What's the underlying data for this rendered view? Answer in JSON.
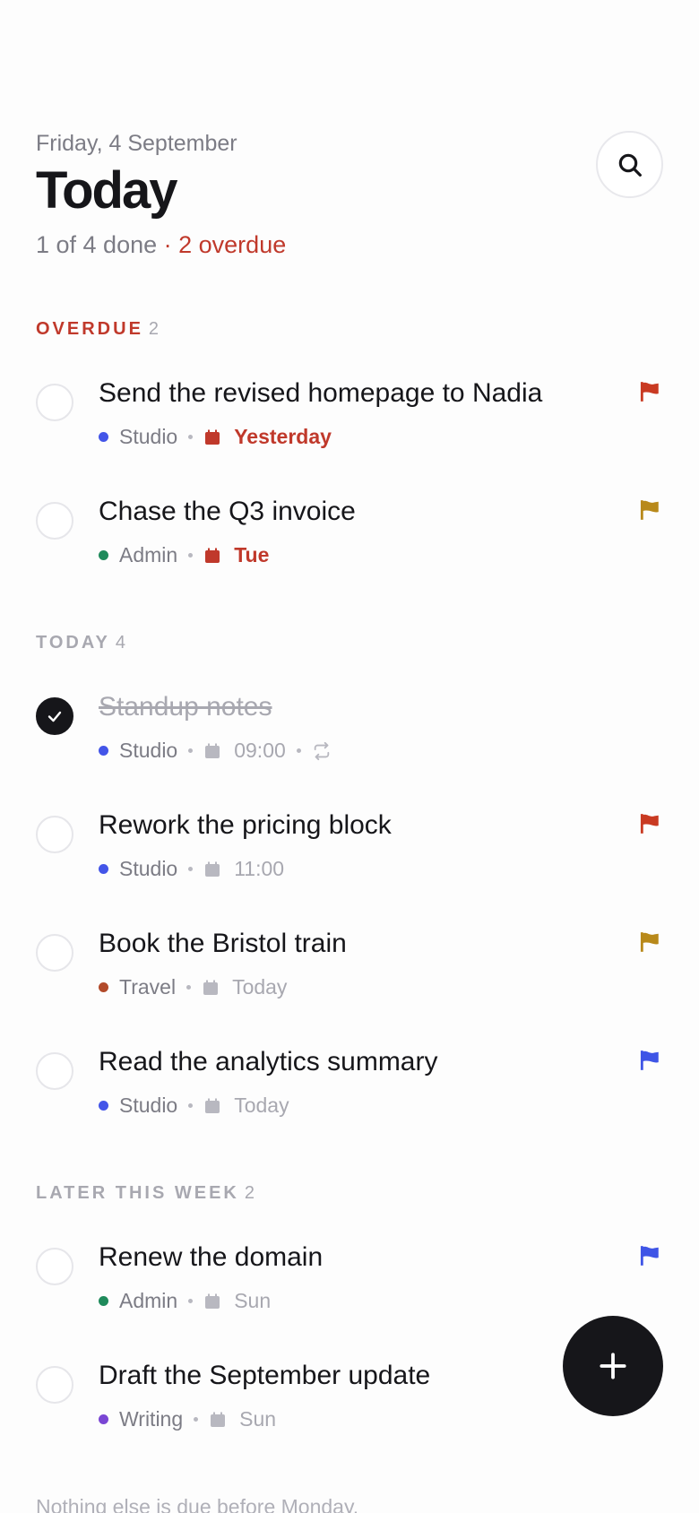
{
  "header": {
    "date": "Friday, 4 September",
    "title": "Today",
    "progress": "1 of 4 done",
    "overdue": "· 2 overdue"
  },
  "sections": {
    "overdue": {
      "label": "OVERDUE",
      "count": "2"
    },
    "today": {
      "label": "TODAY",
      "count": "4"
    },
    "later": {
      "label": "LATER THIS WEEK",
      "count": "2"
    }
  },
  "tasks": [
    {
      "title": "Send the revised homepage to Nadia",
      "project": "Studio",
      "due": "Yesterday",
      "done": false,
      "flag": "red-flag-icon"
    },
    {
      "title": "Chase the Q3 invoice",
      "project": "Admin",
      "due": "Tue",
      "done": false,
      "flag": "amber-flag-icon"
    },
    {
      "title": "Standup notes",
      "project": "Studio",
      "due": "09:00",
      "done": true,
      "flag": "",
      "repeat": "repeat-icon"
    },
    {
      "title": "Rework the pricing block",
      "project": "Studio",
      "due": "11:00",
      "done": false,
      "flag": "red-flag-icon"
    },
    {
      "title": "Book the Bristol train",
      "project": "Travel",
      "due": "Today",
      "done": false,
      "flag": "amber-flag-icon"
    },
    {
      "title": "Read the analytics summary",
      "project": "Studio",
      "due": "Today",
      "done": false,
      "flag": "blue-flag-icon"
    },
    {
      "title": "Renew the domain",
      "project": "Admin",
      "due": "Sun",
      "done": false,
      "flag": "blue-flag-icon"
    },
    {
      "title": "Draft the September update",
      "project": "Writing",
      "due": "Sun",
      "done": false,
      "flag": ""
    }
  ],
  "colors": {
    "studio": "#4355e8",
    "admin": "#1f8a5b",
    "travel": "#b24a2a",
    "writing": "#7a46d4",
    "overdue": "#c0392b",
    "flag_red": "#c93a22",
    "flag_amber": "#b8891a",
    "flag_blue": "#3f55e6"
  },
  "footer": "Nothing else is due before Monday."
}
